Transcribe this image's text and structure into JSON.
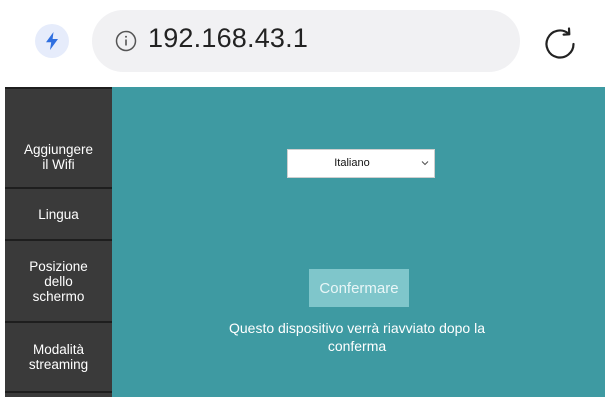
{
  "browser": {
    "url": "192.168.43.1",
    "icons": {
      "quick": "bolt-icon",
      "site_info": "info-icon",
      "reload": "reload-icon"
    },
    "colors": {
      "bolt": "#2f6fe0",
      "bolt_bg": "#e6ecfb",
      "urlbar": "#f1f1f3"
    }
  },
  "sidebar": {
    "items": [
      {
        "label": "Aggiungere\nil Wifi"
      },
      {
        "label": "Lingua"
      },
      {
        "label": "Posizione\ndello\nschermo"
      },
      {
        "label": "Modalità\nstreaming"
      }
    ],
    "colors": {
      "background": "#3a3a3a",
      "text": "#ffffff"
    }
  },
  "main": {
    "language_select": {
      "selected": "Italiano"
    },
    "confirm_label": "Confermare",
    "notice": "Questo dispositivo verrà riavviato dopo la conferma",
    "colors": {
      "background": "#3e9aa2",
      "button": "#7fc6cb"
    }
  }
}
